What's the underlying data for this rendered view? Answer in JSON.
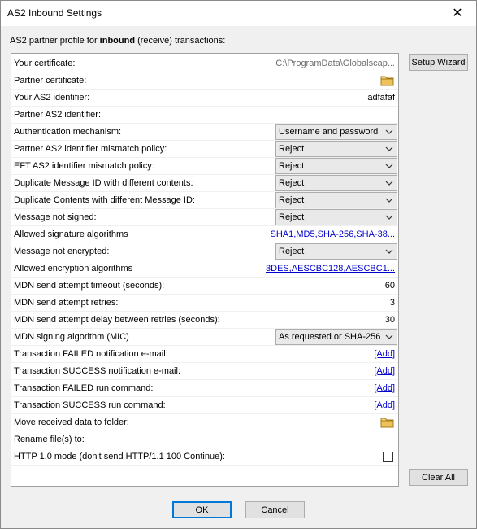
{
  "window": {
    "title": "AS2 Inbound Settings",
    "close_glyph": "✕"
  },
  "subtitle": {
    "prefix": "AS2 partner profile for ",
    "bold": "inbound",
    "suffix": " (receive) transactions:"
  },
  "rows": [
    {
      "label": "Your certificate:",
      "kind": "text-gray",
      "value": "C:\\ProgramData\\Globalscap..."
    },
    {
      "label": "Partner certificate:",
      "kind": "folder"
    },
    {
      "label": "Your AS2 identifier:",
      "kind": "text",
      "value": "adfafaf"
    },
    {
      "label": "Partner AS2 identifier:",
      "kind": "empty"
    },
    {
      "label": "Authentication mechanism:",
      "kind": "combo",
      "value": "Username and password"
    },
    {
      "label": "Partner AS2 identifier mismatch policy:",
      "kind": "combo",
      "value": "Reject"
    },
    {
      "label": "EFT AS2 identifier mismatch policy:",
      "kind": "combo",
      "value": "Reject"
    },
    {
      "label": "Duplicate Message ID with different contents:",
      "kind": "combo",
      "value": "Reject"
    },
    {
      "label": "Duplicate Contents with different Message ID:",
      "kind": "combo",
      "value": "Reject"
    },
    {
      "label": "Message not signed:",
      "kind": "combo",
      "value": "Reject"
    },
    {
      "label": "Allowed signature algorithms",
      "kind": "link",
      "value": "SHA1,MD5,SHA-256,SHA-38..."
    },
    {
      "label": "Message not encrypted:",
      "kind": "combo",
      "value": "Reject"
    },
    {
      "label": "Allowed encryption algorithms",
      "kind": "link",
      "value": "3DES,AESCBC128,AESCBC1..."
    },
    {
      "label": "MDN send attempt timeout (seconds):",
      "kind": "text",
      "value": "60"
    },
    {
      "label": "MDN send attempt retries:",
      "kind": "text",
      "value": "3"
    },
    {
      "label": "MDN send attempt delay between retries (seconds):",
      "kind": "text",
      "value": "30"
    },
    {
      "label": "MDN signing algorithm (MIC)",
      "kind": "combo",
      "value": "As requested or SHA-256"
    },
    {
      "label": "Transaction FAILED notification e-mail:",
      "kind": "link",
      "value": "[Add]"
    },
    {
      "label": "Transaction SUCCESS notification e-mail:",
      "kind": "link",
      "value": "[Add]"
    },
    {
      "label": "Transaction FAILED run command:",
      "kind": "link",
      "value": "[Add]"
    },
    {
      "label": "Transaction SUCCESS run command:",
      "kind": "link",
      "value": "[Add]"
    },
    {
      "label": "Move received data to folder:",
      "kind": "folder"
    },
    {
      "label": "Rename file(s) to:",
      "kind": "empty"
    },
    {
      "label": "HTTP 1.0 mode (don't send HTTP/1.1 100 Continue):",
      "kind": "checkbox",
      "checked": false
    }
  ],
  "buttons": {
    "setup_wizard": "Setup Wizard",
    "clear_all": "Clear All",
    "ok": "OK",
    "cancel": "Cancel"
  },
  "colors": {
    "link": "#0000cc",
    "focus": "#0078d7",
    "folder": "#e8b84a"
  },
  "icons": {
    "combo_arrow": "chevron-down-icon",
    "folder": "folder-icon",
    "close": "close-icon"
  }
}
